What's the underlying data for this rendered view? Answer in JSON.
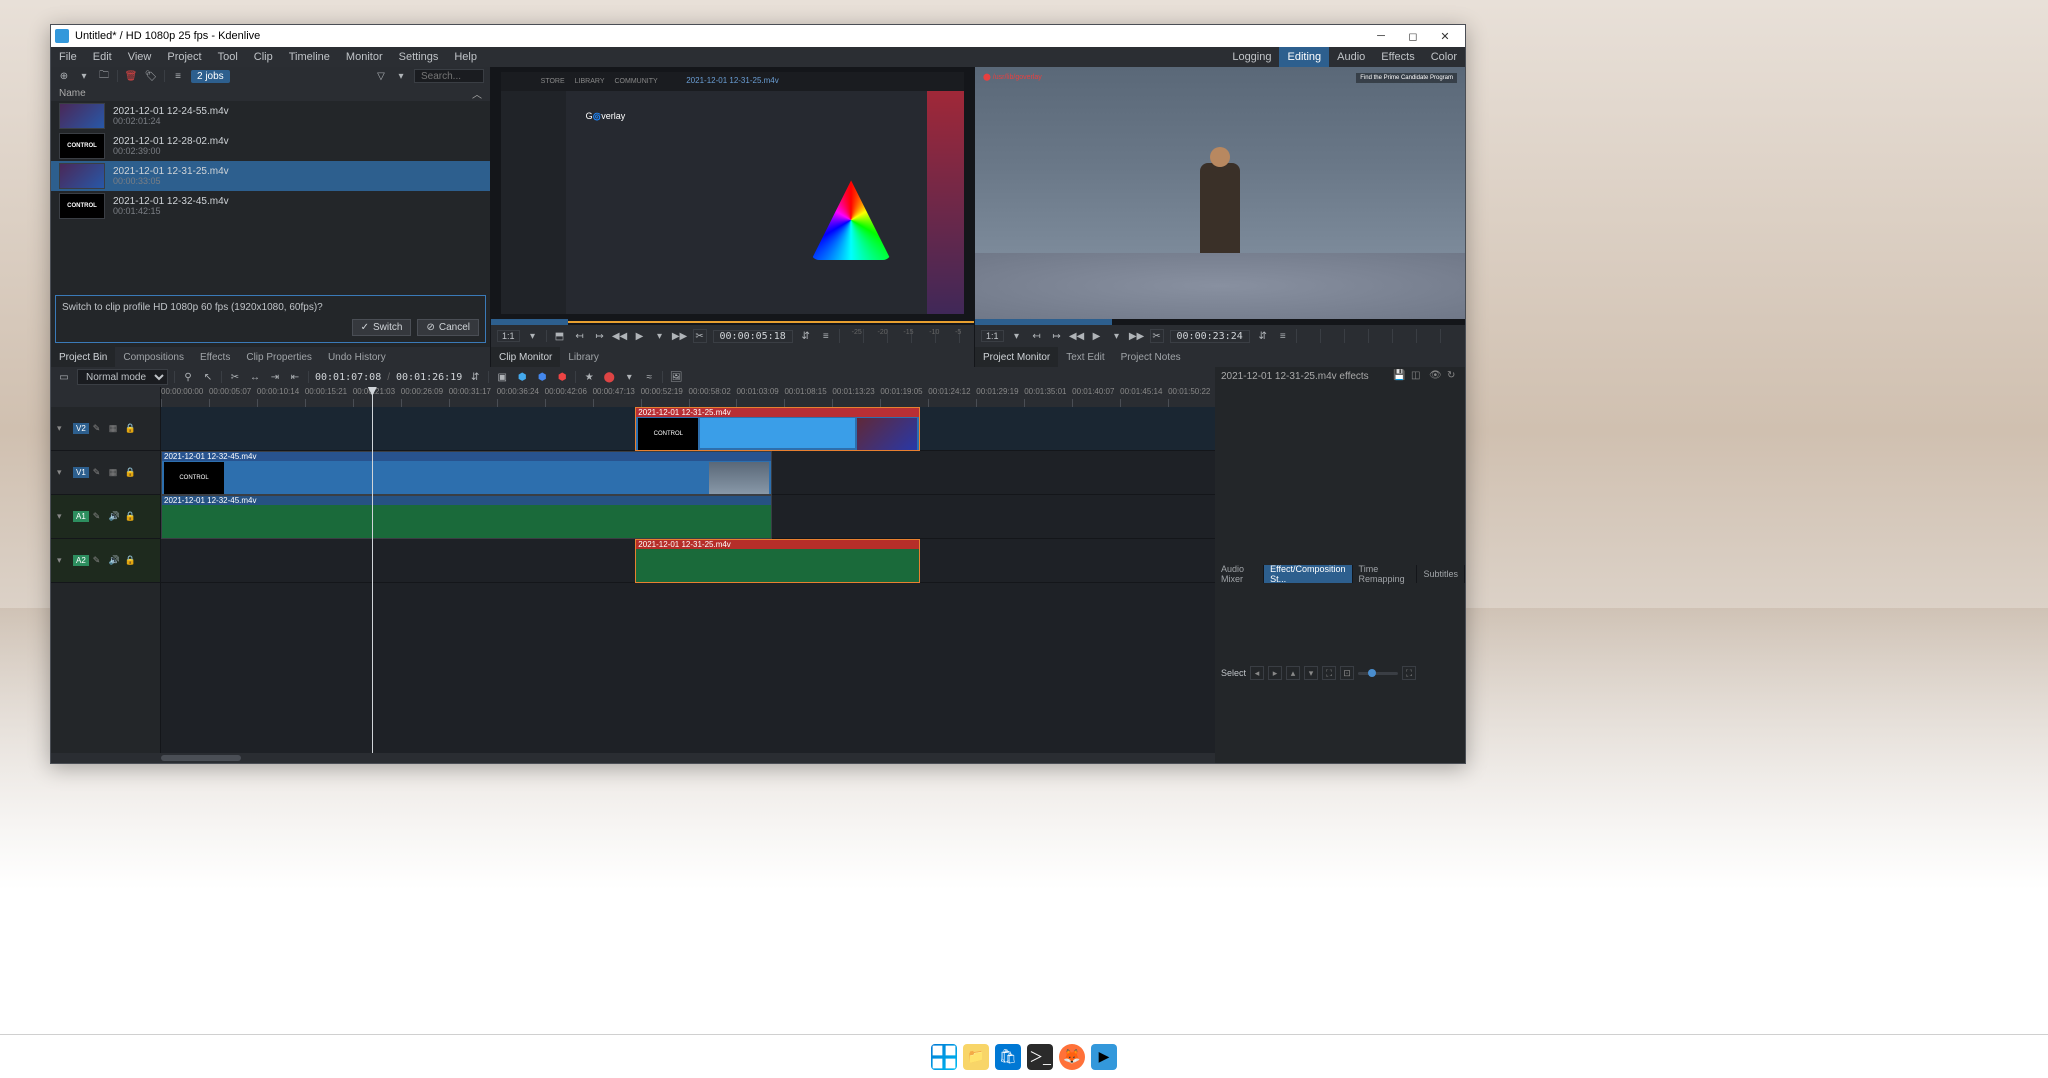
{
  "titlebar": {
    "title": "Untitled* / HD 1080p 25 fps - Kdenlive"
  },
  "menubar": {
    "items": [
      "File",
      "Edit",
      "View",
      "Project",
      "Tool",
      "Clip",
      "Timeline",
      "Monitor",
      "Settings",
      "Help"
    ],
    "rtabs": [
      "Logging",
      "Editing",
      "Audio",
      "Effects",
      "Color"
    ],
    "active_rtab": "Editing"
  },
  "bin": {
    "search_placeholder": "Search...",
    "jobs": "2 jobs",
    "header": "Name",
    "items": [
      {
        "name": "2021-12-01 12-24-55.m4v",
        "dur": "00:02:01:24",
        "kind": "game"
      },
      {
        "name": "2021-12-01 12-28-02.m4v",
        "dur": "00:02:39:00",
        "kind": "control"
      },
      {
        "name": "2021-12-01 12-31-25.m4v",
        "dur": "00:00:33:05",
        "kind": "game"
      },
      {
        "name": "2021-12-01 12-32-45.m4v",
        "dur": "00:01:42:15",
        "kind": "control"
      }
    ],
    "selected": 2,
    "prompt": "Switch to clip profile HD 1080p 60 fps (1920x1080, 60fps)?",
    "switch": "Switch",
    "cancel": "Cancel",
    "tabs": [
      "Project Bin",
      "Compositions",
      "Effects",
      "Clip Properties",
      "Undo History"
    ],
    "active_tab": "Project Bin"
  },
  "clip_monitor": {
    "title": "2021-12-01 12-31-25.m4v",
    "zoom": "1:1",
    "tc": "00:00:05:18",
    "tabs": [
      "Clip Monitor",
      "Library"
    ],
    "active_tab": "Clip Monitor",
    "progress_pct": 16
  },
  "project_monitor": {
    "zoom": "1:1",
    "tc": "00:00:23:24",
    "tabs": [
      "Project Monitor",
      "Text Edit",
      "Project Notes"
    ],
    "active_tab": "Project Monitor",
    "progress_pct": 28
  },
  "fx": {
    "title": "2021-12-01 12-31-25.m4v effects"
  },
  "timeline": {
    "mode": "Normal mode",
    "tc_pos": "00:01:07:08",
    "tc_dur": "00:01:26:19",
    "ticks": [
      "00:00:00:00",
      "00:00:05:07",
      "00:00:10:14",
      "00:00:15:21",
      "00:00:21:03",
      "00:00:26:09",
      "00:00:31:17",
      "00:00:36:24",
      "00:00:42:06",
      "00:00:47:13",
      "00:00:52:19",
      "00:00:58:02",
      "00:01:03:09",
      "00:01:08:15",
      "00:01:13:23",
      "00:01:19:05",
      "00:01:24:12",
      "00:01:29:19",
      "00:01:35:01",
      "00:01:40:07",
      "00:01:45:14",
      "00:01:50:22"
    ],
    "tracks": [
      {
        "id": "V2",
        "kind": "video"
      },
      {
        "id": "V1",
        "kind": "video"
      },
      {
        "id": "A1",
        "kind": "audio"
      },
      {
        "id": "A2",
        "kind": "audio"
      }
    ],
    "clips": {
      "v2": {
        "label": "2021-12-01 12-31-25.m4v",
        "left_pct": 45,
        "width_pct": 27
      },
      "v1": {
        "label": "2021-12-01 12-32-45.m4v",
        "left_pct": 0,
        "width_pct": 58
      },
      "a1": {
        "label": "2021-12-01 12-32-45.m4v",
        "left_pct": 0,
        "width_pct": 58
      },
      "a2": {
        "label": "2021-12-01 12-31-25.m4v",
        "left_pct": 45,
        "width_pct": 27
      }
    },
    "playhead_pct": 20
  },
  "bottom": {
    "tabs": [
      "Audio Mixer",
      "Effect/Composition St...",
      "Time Remapping",
      "Subtitles"
    ],
    "active_tab": "Effect/Composition St...",
    "select_label": "Select"
  }
}
